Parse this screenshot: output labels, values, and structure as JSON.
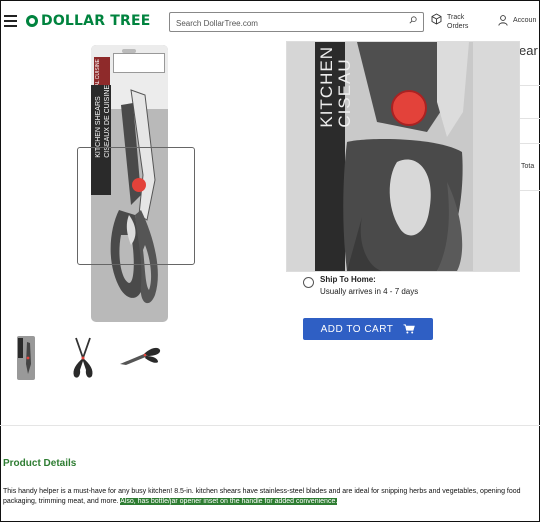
{
  "header": {
    "logo_text": "DOLLAR TREE",
    "search_placeholder": "Search DollarTree.com",
    "track_line1": "Track",
    "track_line2": "Orders",
    "account_label": "Accoun"
  },
  "product": {
    "package_brand": "ROYAL CUISINE",
    "package_line1": "KITCHEN SHEARS",
    "package_line2": "CISEAUX DE CUISINE",
    "zoom_line1": "KITCHEN",
    "zoom_line2": "CISEAU",
    "title_fragment": "ear",
    "total_label": "Tota"
  },
  "shipping": {
    "option_title": "Ship To Home:",
    "option_sub": "Usually arrives in 4 - 7 days"
  },
  "cart": {
    "label": "ADD TO CART"
  },
  "details": {
    "heading": "Product Details",
    "text": "This handy helper is a must-have for any busy kitchen! 8.5-in. kitchen shears have stainless-steel blades and are ideal for snipping herbs and vegetables, opening food packaging, trimming meat, and more.",
    "highlight": "Also, has bottle/jar opener inset on the handle for added convenience."
  },
  "colors": {
    "brand_green": "#00833e",
    "cart_blue": "#2f5fc4",
    "scissor_red": "#e3423a"
  }
}
